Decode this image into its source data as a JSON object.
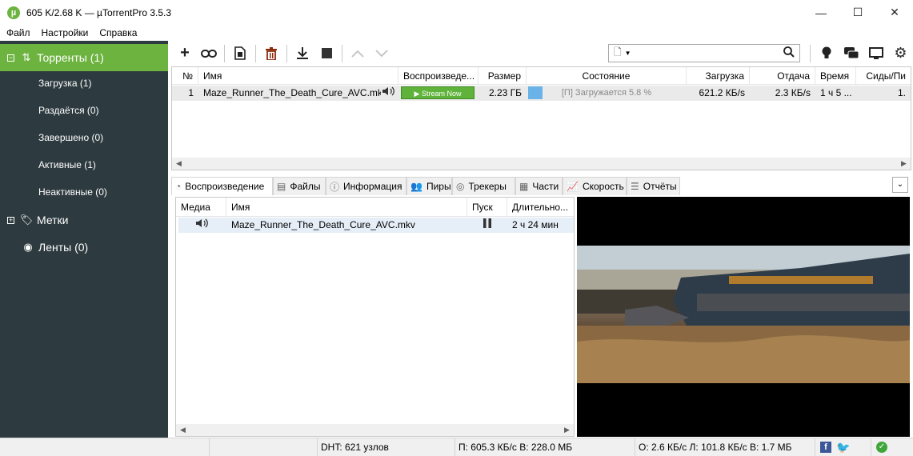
{
  "window": {
    "title": "605 K/2.68 K — µTorrentPro 3.5.3",
    "app_icon": "µ",
    "minimize": "—",
    "maximize": "☐",
    "close": "✕"
  },
  "menu": [
    "Файл",
    "Настройки",
    "Справка"
  ],
  "sidebar": {
    "torrents": {
      "label": "Торренты (1)",
      "expander": "−"
    },
    "sub_items": [
      "Загрузка (1)",
      "Раздаётся (0)",
      "Завершено (0)",
      "Активные (1)",
      "Неактивные (0)"
    ],
    "labels": {
      "label": "Метки",
      "expander": "+"
    },
    "feeds": {
      "label": "Ленты (0)"
    }
  },
  "toolbar": {
    "icons": [
      "add-torrent-icon",
      "add-link-icon",
      "create-torrent-icon",
      "remove-icon",
      "start-icon",
      "stop-icon",
      "move-up-icon",
      "move-down-icon"
    ],
    "right_icons": [
      "bulb-icon",
      "chat-icon",
      "remote-icon",
      "settings-icon"
    ]
  },
  "search": {
    "placeholder": ""
  },
  "torrent_list": {
    "columns": [
      "№",
      "Имя",
      "Воспроизведе...",
      "Размер",
      "Состояние",
      "Загрузка",
      "Отдача",
      "Время",
      "Сиды/Пи"
    ],
    "rows": [
      {
        "num": "1",
        "name": "Maze_Runner_The_Death_Cure_AVC.mkv",
        "stream_label": "▶ Stream Now",
        "size": "2.23 ГБ",
        "status": "[П] Загружается 5.8 %",
        "progress": 0.058,
        "download": "621.2 КБ/s",
        "upload": "2.3 КБ/s",
        "time": "1 ч 5 ...",
        "seeds": "1."
      }
    ]
  },
  "tabs": [
    {
      "label": "Воспроизведение",
      "icon": "playback-icon"
    },
    {
      "label": "Файлы",
      "icon": "files-icon"
    },
    {
      "label": "Информация",
      "icon": "info-icon"
    },
    {
      "label": "Пиры",
      "icon": "peers-icon"
    },
    {
      "label": "Трекеры",
      "icon": "trackers-icon"
    },
    {
      "label": "Части",
      "icon": "pieces-icon"
    },
    {
      "label": "Скорость",
      "icon": "speed-icon"
    },
    {
      "label": "Отчёты",
      "icon": "logger-icon"
    }
  ],
  "playback_list": {
    "columns": [
      "Медиа",
      "Имя",
      "Пуск",
      "Длительно..."
    ],
    "rows": [
      {
        "name": "Maze_Runner_The_Death_Cure_AVC.mkv",
        "duration": "2 ч 24 мин"
      }
    ]
  },
  "statusbar": {
    "dht": "DHT: 621 узлов",
    "download": "П: 605.3 КБ/с В: 228.0 МБ",
    "upload": "О: 2.6 КБ/с Л: 101.8 КБ/с В: 1.7 МБ"
  },
  "colors": {
    "sidebar_bg": "#2d3a3f",
    "sidebar_selected": "#6cb33f",
    "stream_button": "#5fb33b",
    "progress_fill": "#6ab3e8"
  }
}
